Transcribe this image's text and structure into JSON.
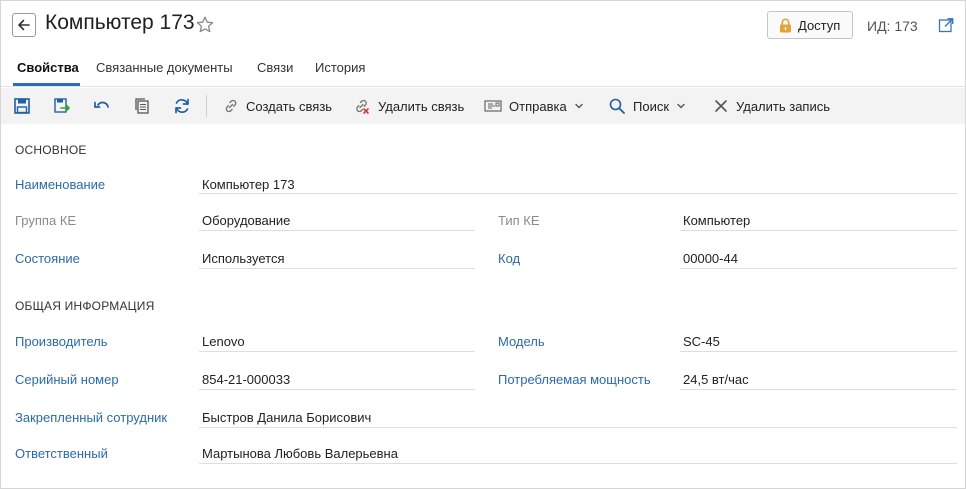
{
  "header": {
    "title": "Компьютер 173",
    "access_label": "Доступ",
    "id_label": "ИД: 173"
  },
  "tabs": [
    {
      "label": "Свойства",
      "active": true
    },
    {
      "label": "Связанные документы",
      "active": false
    },
    {
      "label": "Связи",
      "active": false
    },
    {
      "label": "История",
      "active": false
    }
  ],
  "toolbar": {
    "create_link": "Создать связь",
    "delete_link": "Удалить связь",
    "send": "Отправка",
    "search": "Поиск",
    "delete_record": "Удалить запись"
  },
  "sections": {
    "main": "ОСНОВНОЕ",
    "general": "ОБЩАЯ ИНФОРМАЦИЯ"
  },
  "fields": {
    "name": {
      "label": "Наименование",
      "value": "Компьютер  173"
    },
    "ke_group": {
      "label": "Группа КЕ",
      "value": "Оборудование"
    },
    "ke_type": {
      "label": "Тип КЕ",
      "value": "Компьютер"
    },
    "state": {
      "label": "Состояние",
      "value": "Используется"
    },
    "code": {
      "label": "Код",
      "value": "00000-44"
    },
    "manufacturer": {
      "label": "Производитель",
      "value": "Lenovo"
    },
    "model": {
      "label": "Модель",
      "value": "SC-45"
    },
    "serial": {
      "label": "Серийный номер",
      "value": "854-21-000033"
    },
    "power": {
      "label": "Потребляемая мощность",
      "value": "24,5 вт/час"
    },
    "assigned_employee": {
      "label": "Закрепленный сотрудник",
      "value": "Быстров Данила Борисович"
    },
    "responsible": {
      "label": "Ответственный",
      "value": "Мартынова Любовь Валерьевна"
    }
  },
  "colors": {
    "accent": "#2a6fb7",
    "link": "#2c6aa8",
    "toolbar_bg": "#f3f3f3",
    "lock": "#e0a43a"
  }
}
